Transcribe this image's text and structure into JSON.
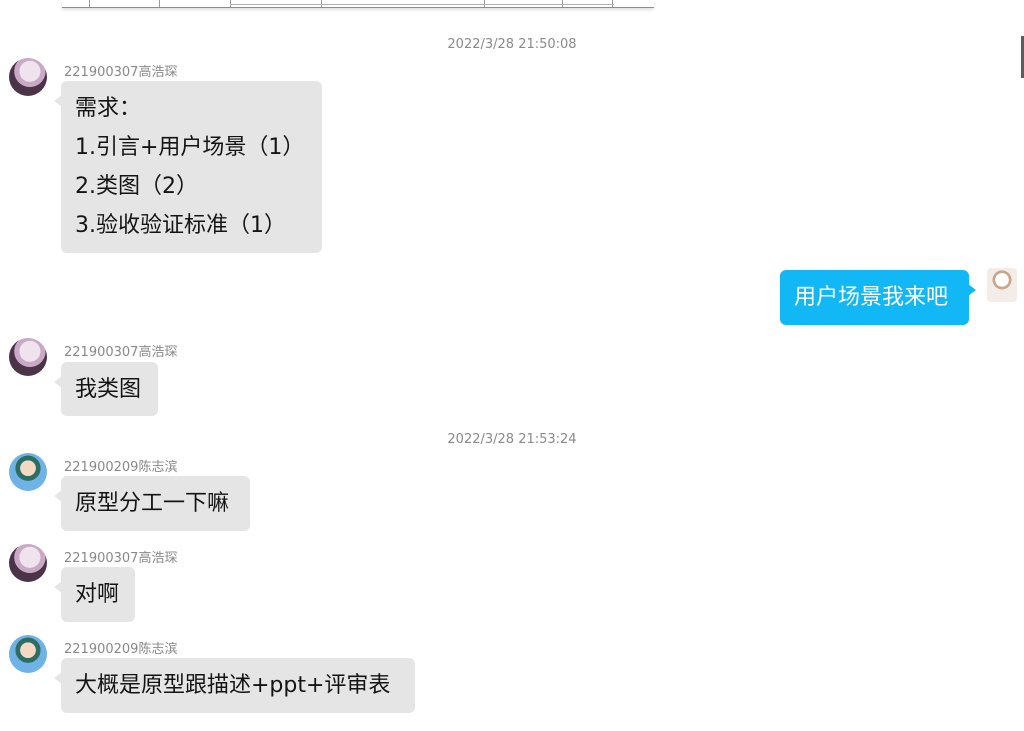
{
  "messages": [
    {
      "timestamp": "2022/3/28 21:50:08"
    },
    {
      "sender": "221900307高浩琛",
      "lines": [
        "需求：",
        "1.引言+用户场景（1）",
        "2.类图（2）",
        "3.验收验证标准（1）"
      ]
    },
    {
      "sender": "self",
      "lines": [
        "用户场景我来吧"
      ]
    },
    {
      "sender": "221900307高浩琛",
      "lines": [
        "我类图"
      ]
    },
    {
      "timestamp": "2022/3/28 21:53:24"
    },
    {
      "sender": "221900209陈志滨",
      "lines": [
        "原型分工一下嘛"
      ]
    },
    {
      "sender": "221900307高浩琛",
      "lines": [
        "对啊"
      ]
    },
    {
      "sender": "221900209陈志滨",
      "lines": [
        "大概是原型跟描述+ppt+评审表"
      ]
    }
  ],
  "colors": {
    "incoming_bubble": "#e5e5e5",
    "outgoing_bubble": "#12b7f5",
    "sender_name": "#888888"
  }
}
